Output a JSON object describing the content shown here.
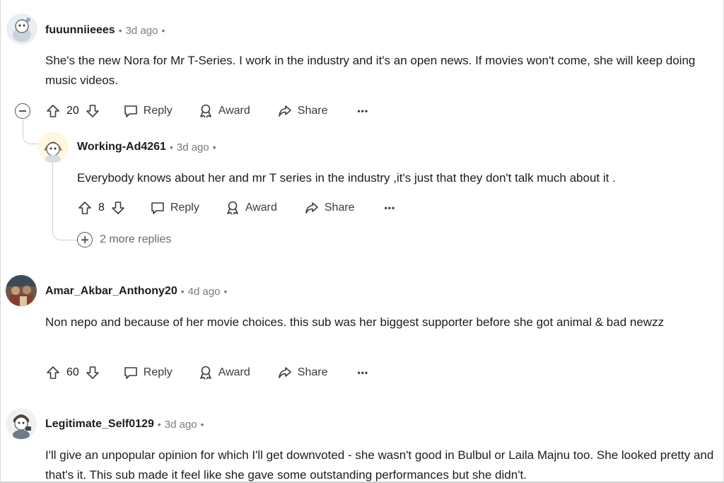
{
  "comments": [
    {
      "user": "fuuunniieees",
      "time": "3d ago",
      "text": "She's the new Nora for Mr T-Series. I work in the industry and it's an open news. If movies won't come, she will keep doing music videos.",
      "votes": "20",
      "reply_label": "Reply",
      "award_label": "Award",
      "share_label": "Share"
    },
    {
      "user": "Working-Ad4261",
      "time": "3d ago",
      "text": "Everybody knows about her and mr T series in the industry ,it's just that they don't talk much about it .",
      "votes": "8",
      "reply_label": "Reply",
      "award_label": "Award",
      "share_label": "Share",
      "more_replies": "2 more replies"
    },
    {
      "user": "Amar_Akbar_Anthony20",
      "time": "4d ago",
      "text": "Non nepo and because of her movie choices. this sub was her biggest supporter before she got animal & bad newzz",
      "votes": "60",
      "reply_label": "Reply",
      "award_label": "Award",
      "share_label": "Share"
    },
    {
      "user": "Legitimate_Self0129",
      "time": "3d ago",
      "text": "I'll give an unpopular opinion for which I'll get downvoted - she wasn't good in Bulbul or Laila Majnu too. She looked pretty and that's it. This sub made it feel like she gave some outstanding performances but she didn't."
    }
  ],
  "separator": "•",
  "overflow_glyph": "•••",
  "colors": {
    "text": "#1c1c1c",
    "muted": "#7c7c7c",
    "thread": "#d0d0d0"
  }
}
